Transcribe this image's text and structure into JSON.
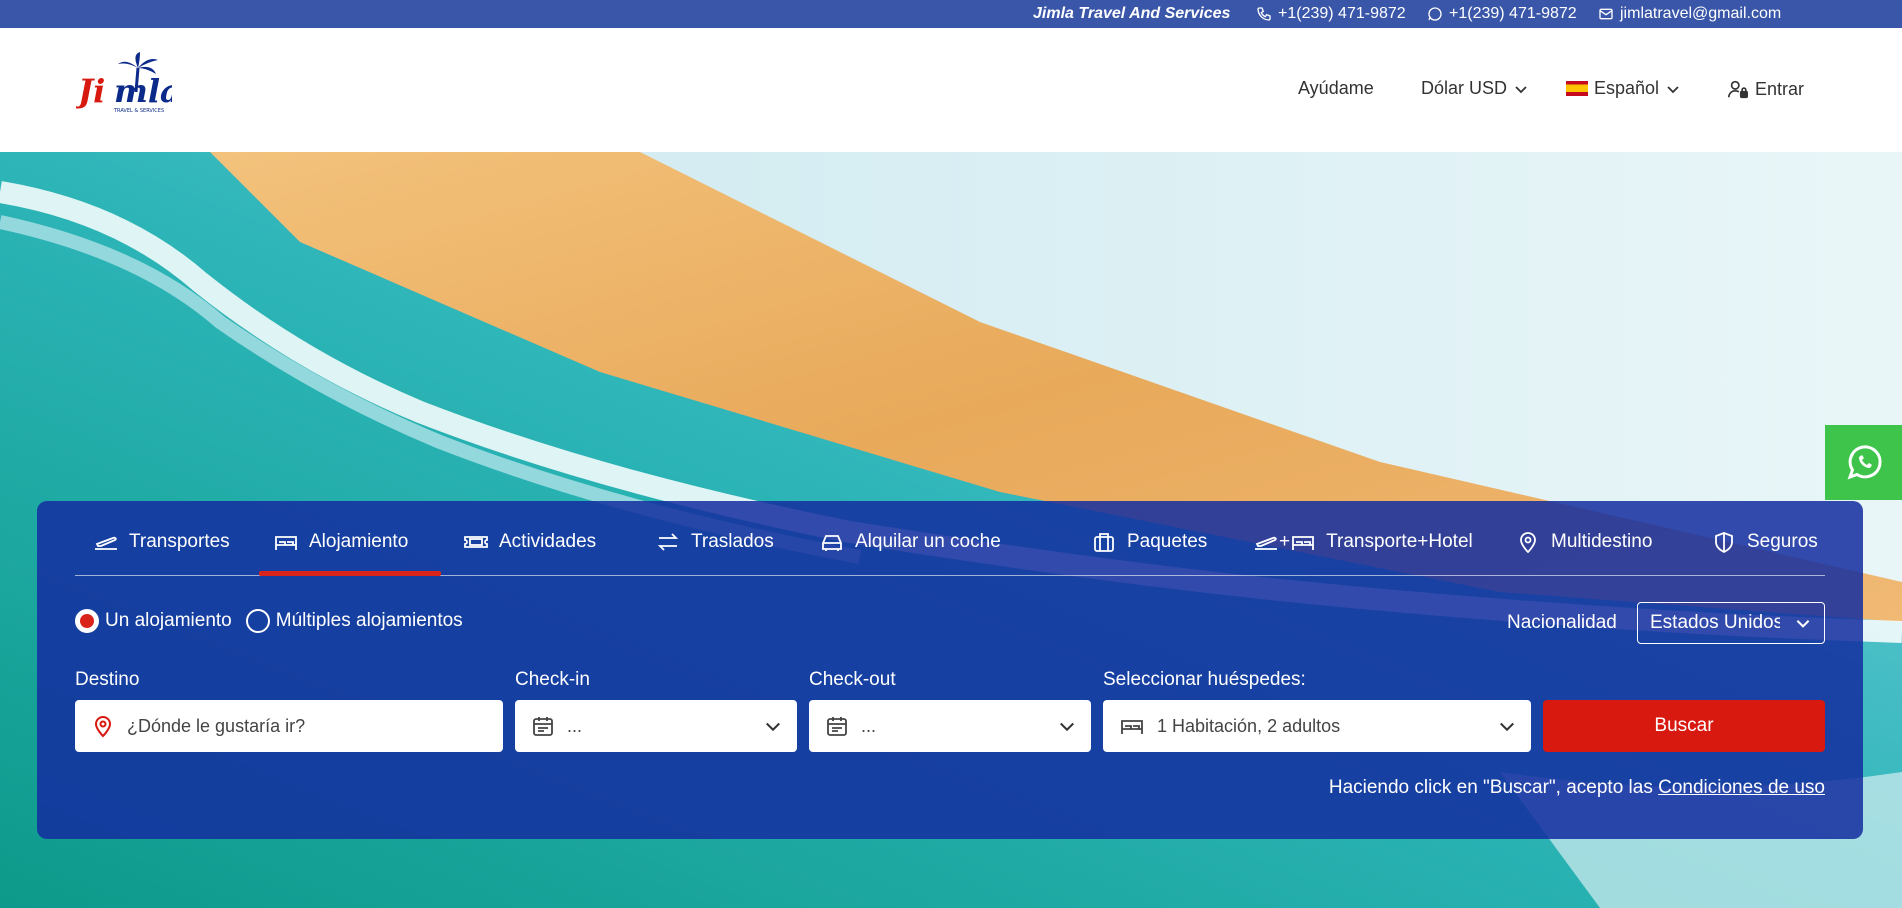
{
  "topbar": {
    "company": "Jimla Travel And Services",
    "phone": "+1(239) 471-9872",
    "whatsapp": "+1(239) 471-9872",
    "email": "jimlatravel@gmail.com"
  },
  "header": {
    "logo_text": "Jimla",
    "logo_sub": "TRAVEL & SERVICES",
    "help": "Ayúdame",
    "currency": "Dólar USD",
    "language": "Español",
    "login": "Entrar"
  },
  "tabs": [
    {
      "label": "Transportes",
      "icon": "plane-icon"
    },
    {
      "label": "Alojamiento",
      "icon": "bed-icon",
      "active": true
    },
    {
      "label": "Actividades",
      "icon": "ticket-icon"
    },
    {
      "label": "Traslados",
      "icon": "transfer-arrows-icon"
    },
    {
      "label": "Alquilar un coche",
      "icon": "car-icon"
    },
    {
      "label": "Paquetes",
      "icon": "suitcase-icon"
    },
    {
      "label": "Transporte+Hotel",
      "icon": "plane-plus-bed-icon",
      "plus": "+"
    },
    {
      "label": "Multidestino",
      "icon": "location-pin-icon"
    },
    {
      "label": "Seguros",
      "icon": "shield-icon"
    }
  ],
  "search": {
    "radio_single": "Un alojamiento",
    "radio_multiple": "Múltiples alojamientos",
    "nationality_label": "Nacionalidad",
    "nationality_value": "Estados Unidos",
    "destination_label": "Destino",
    "destination_placeholder": "¿Dónde le gustaría ir?",
    "checkin_label": "Check-in",
    "checkin_value": "...",
    "checkout_label": "Check-out",
    "checkout_value": "...",
    "guests_label": "Seleccionar huéspedes:",
    "guests_value": "1 Habitación, 2 adultos",
    "button": "Buscar",
    "terms_text": "Haciendo click en \"Buscar\", acepto las ",
    "terms_link": "Condiciones de uso"
  },
  "colors": {
    "topbar": "#3a56a8",
    "panel": "#142da0",
    "accent_red": "#d8190f",
    "whatsapp_green": "#3ec44b"
  }
}
